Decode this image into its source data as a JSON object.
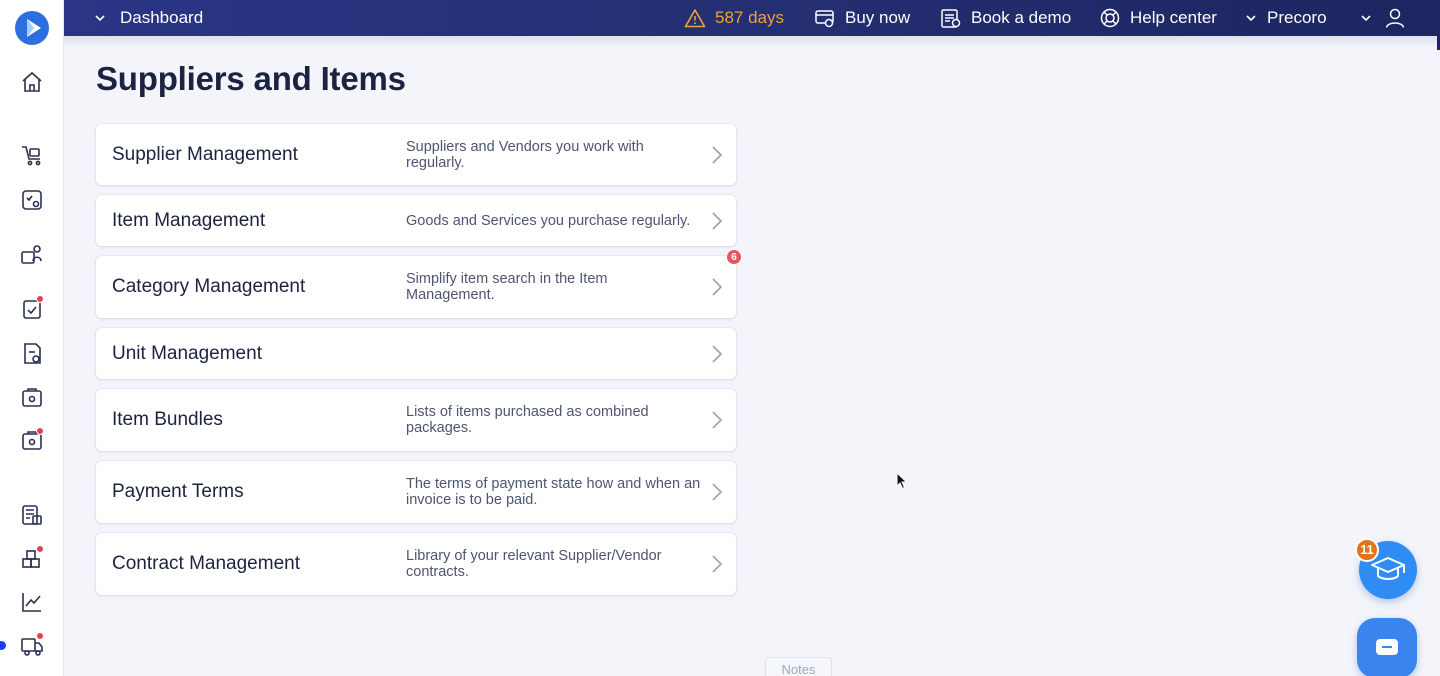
{
  "topbar": {
    "dashboard_label": "Dashboard",
    "trial_days": "587 days",
    "buy_now": "Buy now",
    "book_demo": "Book a demo",
    "help_center": "Help center",
    "company": "Precoro"
  },
  "page": {
    "title": "Suppliers and Items"
  },
  "cards": [
    {
      "title": "Supplier Management",
      "description": "Suppliers and Vendors you work with regularly."
    },
    {
      "title": "Item Management",
      "description": "Goods and Services you purchase regularly."
    },
    {
      "title": "Category Management",
      "description": "Simplify item search in the Item Management.",
      "badge": "6"
    },
    {
      "title": "Unit Management",
      "description": ""
    },
    {
      "title": "Item Bundles",
      "description": "Lists of items purchased as combined packages."
    },
    {
      "title": "Payment Terms",
      "description": "The terms of payment state how and when an invoice is to be paid."
    },
    {
      "title": "Contract Management",
      "description": "Library of your relevant Supplier/Vendor contracts."
    }
  ],
  "widgets": {
    "education_badge": "11",
    "notes_label": "Notes"
  },
  "colors": {
    "topbar": "#232d6f",
    "warning": "#f2a03a",
    "notification": "#e8414e",
    "accent": "#2f8cf5"
  }
}
